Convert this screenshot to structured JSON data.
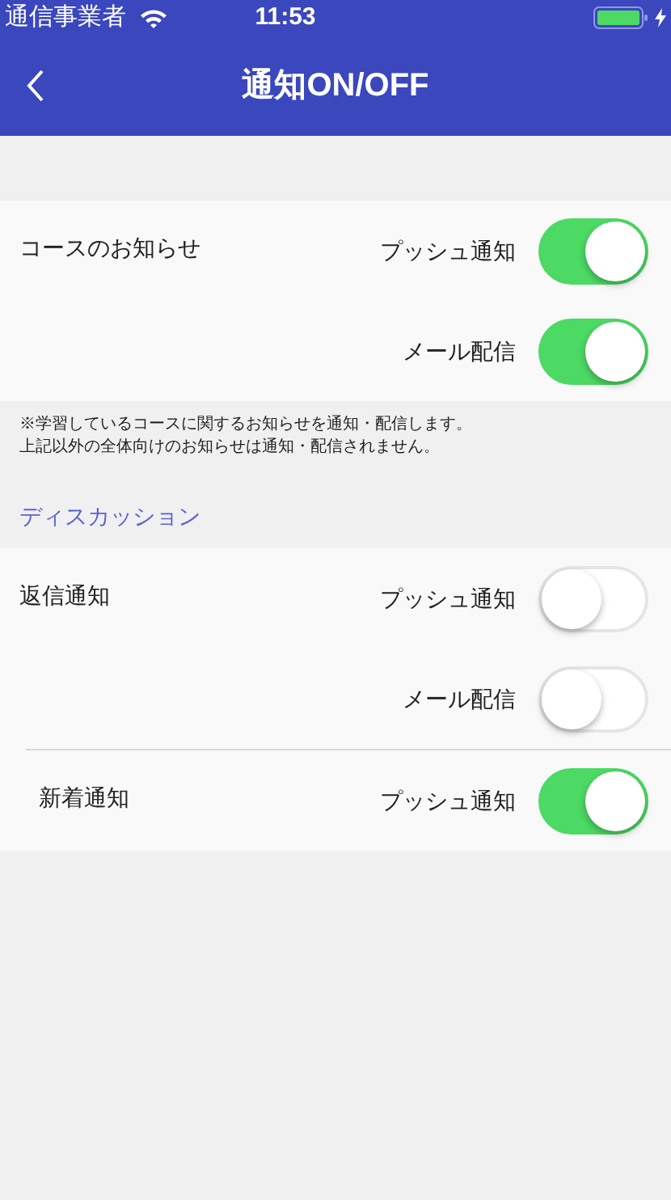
{
  "status_bar": {
    "carrier": "通信事業者",
    "time": "11:53"
  },
  "nav": {
    "title": "通知ON/OFF"
  },
  "sections": [
    {
      "groups": [
        {
          "label": "コースのお知らせ",
          "toggles": [
            {
              "label": "プッシュ通知",
              "on": true
            },
            {
              "label": "メール配信",
              "on": true
            }
          ]
        }
      ],
      "notes": [
        "※学習しているコースに関するお知らせを通知・配信します。",
        "上記以外の全体向けのお知らせは通知・配信されません。"
      ]
    },
    {
      "header": "ディスカッション",
      "groups": [
        {
          "label": "返信通知",
          "toggles": [
            {
              "label": "プッシュ通知",
              "on": false
            },
            {
              "label": "メール配信",
              "on": false
            }
          ]
        },
        {
          "label": "新着通知",
          "toggles": [
            {
              "label": "プッシュ通知",
              "on": true
            }
          ]
        }
      ]
    }
  ]
}
